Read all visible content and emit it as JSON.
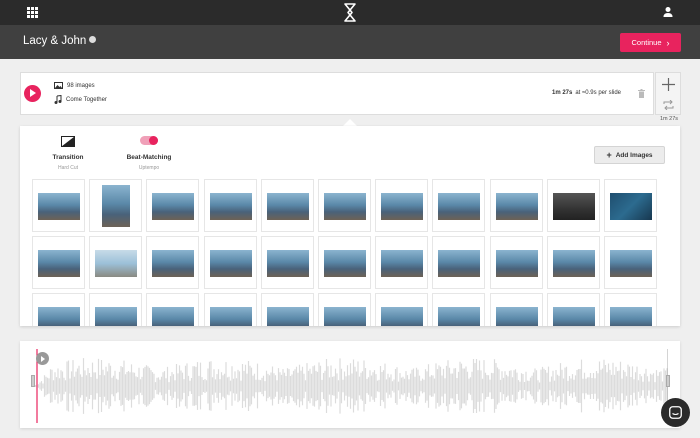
{
  "topbar": {
    "apps_icon": "grid-icon",
    "logo_icon": "brand-logo-icon",
    "user_icon": "user-icon"
  },
  "project": {
    "title": "Lacy & John",
    "settings_icon": "gear-icon"
  },
  "continue_label": "Continue",
  "slideshow": {
    "images_text": "98 images",
    "song_text": "Come Together",
    "duration": "1m 27s",
    "per_slide": "at ≈0.9s per slide"
  },
  "total_duration": "1m 27s",
  "options": {
    "transition_label": "Transition",
    "transition_value": "Hard Cut",
    "beat_label": "Beat-Matching",
    "beat_value": "Uptempo",
    "beat_enabled": true
  },
  "add_images_label": "Add Images",
  "photos": [
    "photo",
    "photo",
    "photo",
    "photo",
    "photo",
    "photo",
    "photo",
    "photo",
    "photo",
    "photo",
    "photo",
    "photo",
    "photo",
    "photo",
    "photo",
    "photo",
    "photo",
    "photo",
    "photo",
    "photo",
    "photo",
    "photo",
    "photo",
    "photo",
    "photo",
    "photo",
    "photo",
    "photo",
    "photo",
    "photo",
    "photo",
    "photo",
    "photo"
  ],
  "colors": {
    "accent": "#e8235e",
    "topbar": "#2b2b2b",
    "titlebar": "#404040"
  }
}
